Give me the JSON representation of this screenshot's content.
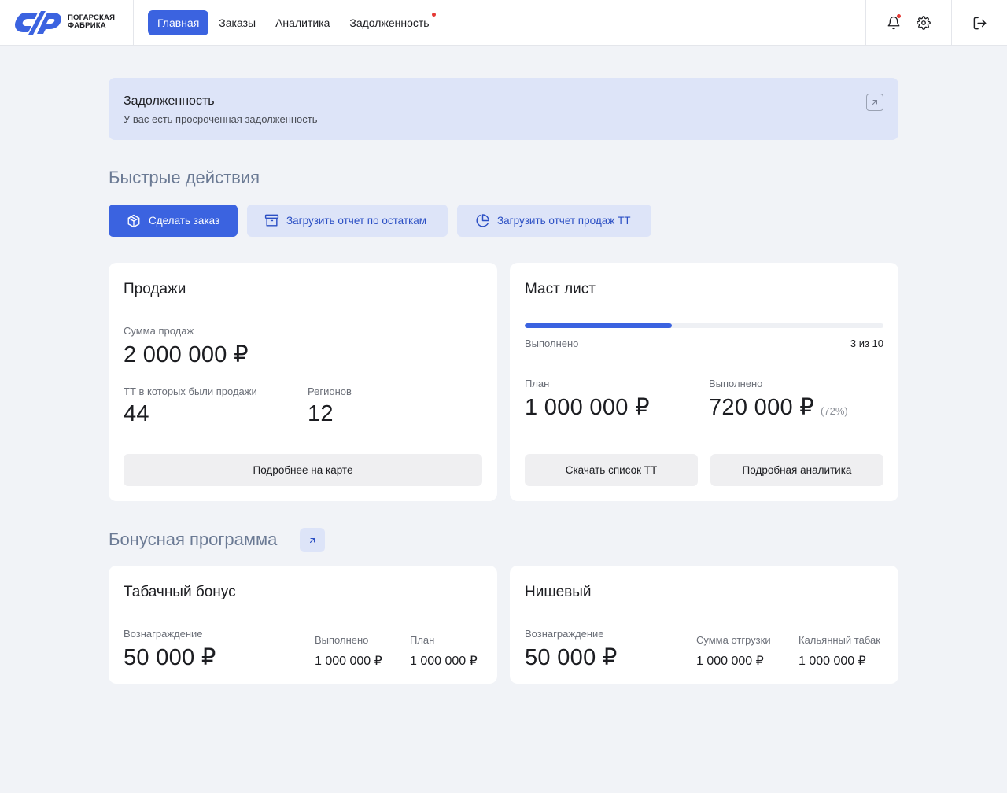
{
  "brand": {
    "line1": "ПОГАРСКАЯ",
    "line2": "ФАБРИКА",
    "color": "#3b63e0"
  },
  "nav": {
    "items": [
      {
        "label": "Главная",
        "active": true
      },
      {
        "label": "Заказы"
      },
      {
        "label": "Аналитика"
      },
      {
        "label": "Задолженность",
        "badge": true
      }
    ]
  },
  "header_icons": [
    "bell-icon",
    "gear-icon",
    "logout-icon"
  ],
  "alert": {
    "title": "Задолженность",
    "text": "У вас есть просроченная задолженность"
  },
  "quick_actions": {
    "title": "Быстрые действия",
    "buttons": [
      {
        "label": "Сделать заказ",
        "icon": "box-icon"
      },
      {
        "label": "Загрузить отчет по остаткам",
        "icon": "archive-icon"
      },
      {
        "label": "Загрузить отчет продаж ТТ",
        "icon": "pie-chart-icon"
      }
    ]
  },
  "sales": {
    "title": "Продажи",
    "sum_label": "Сумма продаж",
    "sum_value": "2 000 000 ₽",
    "tt_label": "ТТ в которых были продажи",
    "tt_value": "44",
    "regions_label": "Регионов",
    "regions_value": "12",
    "button": "Подробнее на карте"
  },
  "must_list": {
    "title": "Маст лист",
    "progress_fraction": 0.3,
    "done_label": "Выполнено",
    "done_count": "3 из 10",
    "plan_label": "План",
    "plan_value": "1 000 000 ₽",
    "executed_label": "Выполнено",
    "executed_value": "720 000 ₽",
    "executed_pct": "(72%)",
    "button_download": "Скачать список ТТ",
    "button_analytics": "Подробная аналитика"
  },
  "bonus": {
    "title": "Бонусная программа",
    "tobacco": {
      "title": "Табачный бонус",
      "reward_label": "Вознаграждение",
      "reward_value": "50 000 ₽",
      "done_label": "Выполнено",
      "done_value": "1 000 000 ₽",
      "plan_label": "План",
      "plan_value": "1 000 000 ₽"
    },
    "niche": {
      "title": "Нишевый",
      "reward_label": "Вознаграждение",
      "reward_value": "50 000 ₽",
      "shipment_label": "Сумма отгрузки",
      "shipment_value": "1 000 000 ₽",
      "hookah_label": "Кальянный табак",
      "hookah_value": "1 000 000 ₽"
    }
  }
}
